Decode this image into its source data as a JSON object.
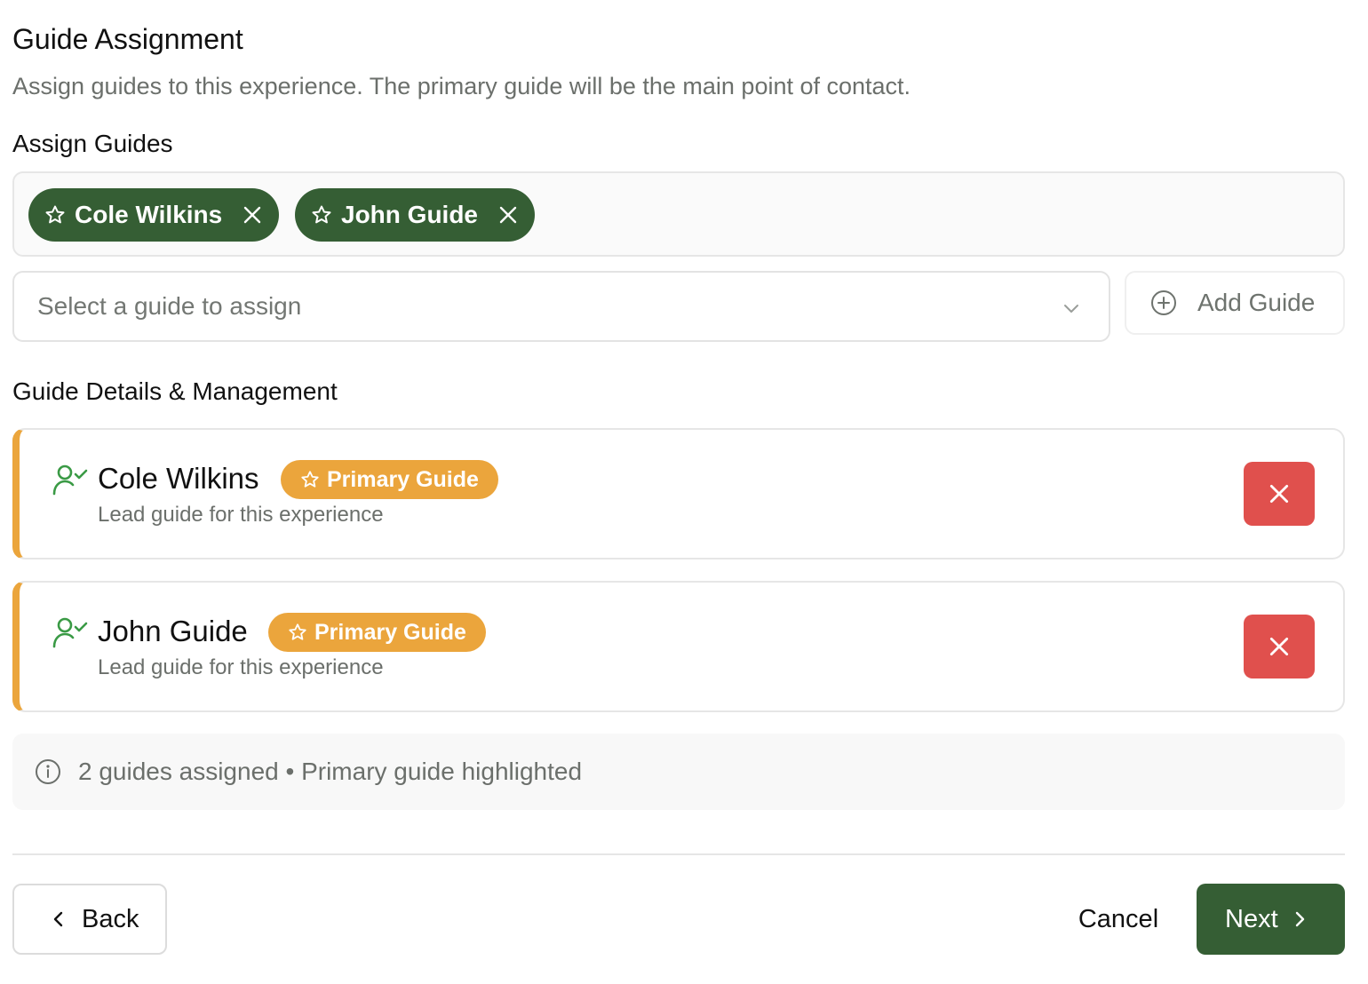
{
  "header": {
    "title": "Guide Assignment",
    "subtitle": "Assign guides to this experience. The primary guide will be the main point of contact."
  },
  "assign": {
    "label": "Assign Guides",
    "chips": [
      {
        "name": "Cole Wilkins",
        "icon": "star-icon",
        "remove_icon": "close-icon"
      },
      {
        "name": "John Guide",
        "icon": "star-icon",
        "remove_icon": "close-icon"
      }
    ],
    "select_placeholder": "Select a guide to assign",
    "add_button": "Add Guide"
  },
  "details": {
    "label": "Guide Details & Management",
    "cards": [
      {
        "name": "Cole Wilkins",
        "badge": "Primary Guide",
        "description": "Lead guide for this experience",
        "icon": "user-check-icon"
      },
      {
        "name": "John Guide",
        "badge": "Primary Guide",
        "description": "Lead guide for this experience",
        "icon": "user-check-icon"
      }
    ]
  },
  "info": {
    "text": "2 guides assigned • Primary guide highlighted"
  },
  "footer": {
    "back": "Back",
    "cancel": "Cancel",
    "next": "Next"
  },
  "colors": {
    "primary_green": "#355e34",
    "primary_badge": "#eba53c",
    "remove_red": "#e0504d",
    "user_icon_green": "#3a9a45"
  }
}
